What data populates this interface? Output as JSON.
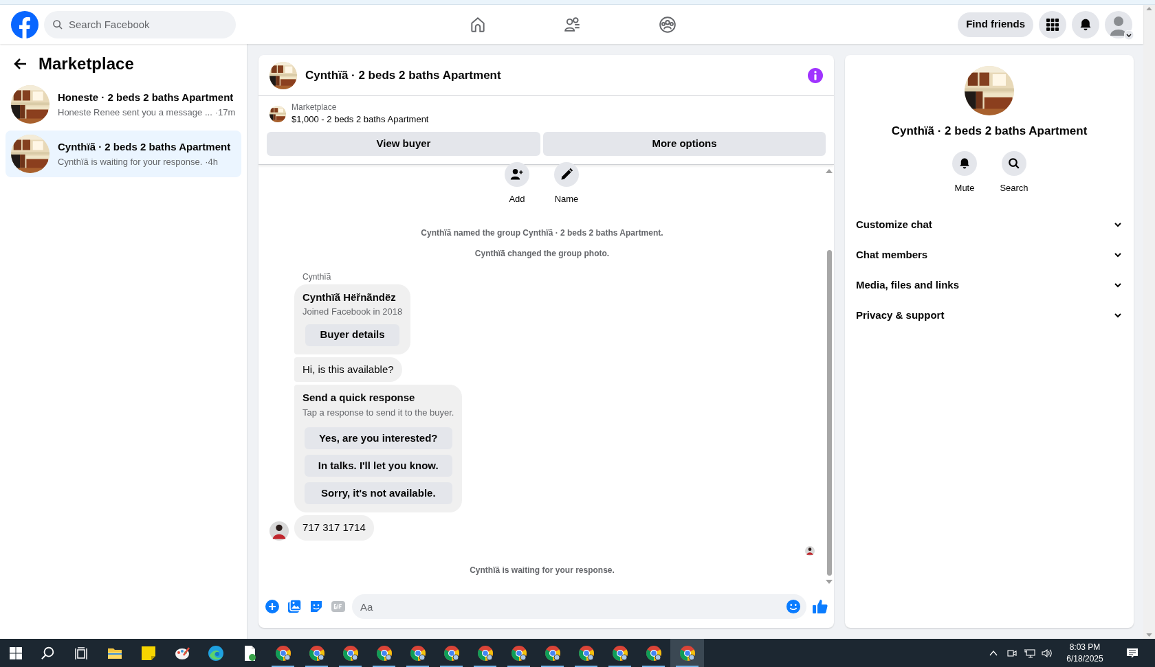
{
  "header": {
    "search": {
      "placeholder": "Search Facebook"
    },
    "nav": [
      {
        "kind": "home"
      },
      {
        "kind": "friends"
      },
      {
        "kind": "groups"
      }
    ],
    "find_friends": "Find friends"
  },
  "sidebar": {
    "title": "Marketplace",
    "conversations": [
      {
        "title": "Honeste · 2 beds 2 baths Apartment",
        "preview": "Honeste Renee sent you a message ...",
        "time": "·17m",
        "selected": false
      },
      {
        "title": "Cynthïã · 2 beds 2 baths Apartment",
        "preview": "Cynthïã is waiting for your response.",
        "time": "·4h",
        "selected": true
      }
    ]
  },
  "chat": {
    "title": "Cynthïã · 2 beds 2 baths Apartment",
    "listing": {
      "label": "Marketplace",
      "text": "$1,000 - 2 beds 2 baths Apartment"
    },
    "buttons": [
      "View buyer",
      "More options"
    ],
    "actions": [
      {
        "kind": "add",
        "label": "Add"
      },
      {
        "kind": "name",
        "label": "Name"
      }
    ],
    "events": [
      "Cynthïã named the group Cynthïã · 2 beds 2 baths Apartment.",
      "Cynthïã changed the group photo."
    ],
    "sender": "Cynthïã",
    "messages": [
      {
        "kind": "profile",
        "name": "Cynthïã Hëřnãndëz",
        "subtitle": "Joined Facebook in 2018",
        "button": "Buyer details",
        "avatar": false
      },
      {
        "kind": "text",
        "text": "Hi, is this available?",
        "avatar": false
      },
      {
        "kind": "quick",
        "title": "Send a quick response",
        "subtitle": "Tap a response to send it to the buyer.",
        "options": [
          "Yes, are you interested?",
          "In talks. I'll let you know.",
          "Sorry, it's not available."
        ],
        "avatar": false
      },
      {
        "kind": "text",
        "text": "717 317 1714",
        "avatar": true
      }
    ],
    "waiting": "Cynthïã is waiting for your response.",
    "composer": {
      "placeholder": "Aa"
    }
  },
  "details": {
    "title": "Cynthïã · 2 beds 2 baths Apartment",
    "actions": [
      {
        "kind": "mute",
        "label": "Mute"
      },
      {
        "kind": "search",
        "label": "Search"
      }
    ],
    "sections": [
      {
        "label": "Customize chat",
        "expanded": false
      },
      {
        "label": "Chat members",
        "expanded": false
      },
      {
        "label": "Media, files and links",
        "expanded": false
      },
      {
        "label": "Privacy & support",
        "expanded": false
      }
    ]
  },
  "taskbar": {
    "apps": [
      {
        "kind": "explorer",
        "selected": false
      },
      {
        "kind": "notes",
        "selected": false
      },
      {
        "kind": "paint",
        "selected": false
      },
      {
        "kind": "edge",
        "selected": false
      },
      {
        "kind": "file",
        "selected": false
      },
      {
        "kind": "chrome",
        "selected": false
      },
      {
        "kind": "chrome",
        "selected": false
      },
      {
        "kind": "chrome",
        "selected": false
      },
      {
        "kind": "chrome",
        "selected": false
      },
      {
        "kind": "chrome",
        "selected": false
      },
      {
        "kind": "chrome",
        "selected": false
      },
      {
        "kind": "chrome",
        "selected": false
      },
      {
        "kind": "chrome",
        "selected": false
      },
      {
        "kind": "chrome",
        "selected": false
      },
      {
        "kind": "chrome",
        "selected": false
      },
      {
        "kind": "chrome",
        "selected": false
      },
      {
        "kind": "chrome",
        "selected": false
      },
      {
        "kind": "chrome",
        "selected": true
      }
    ],
    "time": "8:03 PM",
    "date": "6/18/2025"
  }
}
